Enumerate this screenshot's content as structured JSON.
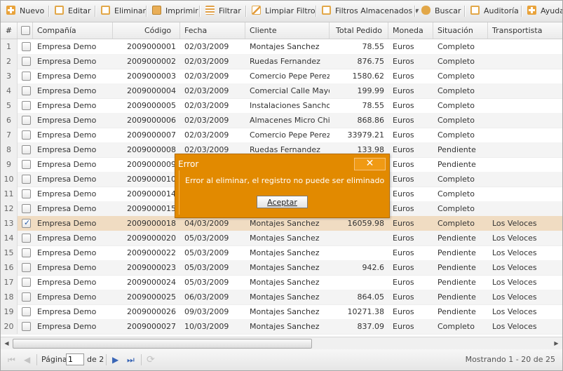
{
  "toolbar": {
    "new_label": "Nuevo",
    "edit_label": "Editar",
    "delete_label": "Eliminar",
    "print_label": "Imprimir",
    "filter_label": "Filtrar",
    "clear_filter_label": "Limpiar Filtro",
    "stored_filters_label": "Filtros Almacenados",
    "search_label": "Buscar",
    "audit_label": "Auditoría",
    "help_label": "Ayuda"
  },
  "grid": {
    "columns": [
      "#",
      "",
      "Compañía",
      "Código",
      "Fecha",
      "Cliente",
      "Total Pedido",
      "Moneda",
      "Situación",
      "Transportista"
    ],
    "rows": [
      {
        "n": "1",
        "checked": false,
        "company": "Empresa Demo",
        "code": "2009000001",
        "date": "02/03/2009",
        "client": "Montajes Sanchez",
        "total": "78.55",
        "currency": "Euros",
        "status": "Completo",
        "carrier": ""
      },
      {
        "n": "2",
        "checked": false,
        "company": "Empresa Demo",
        "code": "2009000002",
        "date": "02/03/2009",
        "client": "Ruedas Fernandez",
        "total": "876.75",
        "currency": "Euros",
        "status": "Completo",
        "carrier": ""
      },
      {
        "n": "3",
        "checked": false,
        "company": "Empresa Demo",
        "code": "2009000003",
        "date": "02/03/2009",
        "client": "Comercio Pepe Perez",
        "total": "1580.62",
        "currency": "Euros",
        "status": "Completo",
        "carrier": ""
      },
      {
        "n": "4",
        "checked": false,
        "company": "Empresa Demo",
        "code": "2009000004",
        "date": "02/03/2009",
        "client": "Comercial Calle Mayor",
        "total": "199.99",
        "currency": "Euros",
        "status": "Completo",
        "carrier": ""
      },
      {
        "n": "5",
        "checked": false,
        "company": "Empresa Demo",
        "code": "2009000005",
        "date": "02/03/2009",
        "client": "Instalaciones Sancho",
        "total": "78.55",
        "currency": "Euros",
        "status": "Completo",
        "carrier": ""
      },
      {
        "n": "6",
        "checked": false,
        "company": "Empresa Demo",
        "code": "2009000006",
        "date": "02/03/2009",
        "client": "Almacenes Micro Chip",
        "total": "868.86",
        "currency": "Euros",
        "status": "Completo",
        "carrier": ""
      },
      {
        "n": "7",
        "checked": false,
        "company": "Empresa Demo",
        "code": "2009000007",
        "date": "02/03/2009",
        "client": "Comercio Pepe Perez",
        "total": "33979.21",
        "currency": "Euros",
        "status": "Completo",
        "carrier": ""
      },
      {
        "n": "8",
        "checked": false,
        "company": "Empresa Demo",
        "code": "2009000008",
        "date": "02/03/2009",
        "client": "Ruedas Fernandez",
        "total": "133.98",
        "currency": "Euros",
        "status": "Pendiente",
        "carrier": ""
      },
      {
        "n": "9",
        "checked": false,
        "company": "Empresa Demo",
        "code": "2009000009",
        "date": "",
        "client": "",
        "total": "",
        "currency": "Euros",
        "status": "Pendiente",
        "carrier": ""
      },
      {
        "n": "10",
        "checked": false,
        "company": "Empresa Demo",
        "code": "2009000010",
        "date": "",
        "client": "",
        "total": "",
        "currency": "Euros",
        "status": "Completo",
        "carrier": ""
      },
      {
        "n": "11",
        "checked": false,
        "company": "Empresa Demo",
        "code": "2009000014",
        "date": "",
        "client": "",
        "total": "",
        "currency": "Euros",
        "status": "Completo",
        "carrier": ""
      },
      {
        "n": "12",
        "checked": false,
        "company": "Empresa Demo",
        "code": "2009000015",
        "date": "",
        "client": "",
        "total": "",
        "currency": "Euros",
        "status": "Completo",
        "carrier": ""
      },
      {
        "n": "13",
        "checked": true,
        "company": "Empresa Demo",
        "code": "2009000018",
        "date": "04/03/2009",
        "client": "Montajes Sanchez",
        "total": "16059.98",
        "currency": "Euros",
        "status": "Completo",
        "carrier": "Los Veloces"
      },
      {
        "n": "14",
        "checked": false,
        "company": "Empresa Demo",
        "code": "2009000020",
        "date": "05/03/2009",
        "client": "Montajes Sanchez",
        "total": "",
        "currency": "Euros",
        "status": "Pendiente",
        "carrier": "Los Veloces"
      },
      {
        "n": "15",
        "checked": false,
        "company": "Empresa Demo",
        "code": "2009000022",
        "date": "05/03/2009",
        "client": "Montajes Sanchez",
        "total": "",
        "currency": "Euros",
        "status": "Pendiente",
        "carrier": "Los Veloces"
      },
      {
        "n": "16",
        "checked": false,
        "company": "Empresa Demo",
        "code": "2009000023",
        "date": "05/03/2009",
        "client": "Montajes Sanchez",
        "total": "942.6",
        "currency": "Euros",
        "status": "Pendiente",
        "carrier": "Los Veloces"
      },
      {
        "n": "17",
        "checked": false,
        "company": "Empresa Demo",
        "code": "2009000024",
        "date": "05/03/2009",
        "client": "Montajes Sanchez",
        "total": "",
        "currency": "Euros",
        "status": "Pendiente",
        "carrier": "Los Veloces"
      },
      {
        "n": "18",
        "checked": false,
        "company": "Empresa Demo",
        "code": "2009000025",
        "date": "06/03/2009",
        "client": "Montajes Sanchez",
        "total": "864.05",
        "currency": "Euros",
        "status": "Pendiente",
        "carrier": "Los Veloces"
      },
      {
        "n": "19",
        "checked": false,
        "company": "Empresa Demo",
        "code": "2009000026",
        "date": "09/03/2009",
        "client": "Montajes Sanchez",
        "total": "10271.38",
        "currency": "Euros",
        "status": "Pendiente",
        "carrier": "Los Veloces"
      },
      {
        "n": "20",
        "checked": false,
        "company": "Empresa Demo",
        "code": "2009000027",
        "date": "10/03/2009",
        "client": "Montajes Sanchez",
        "total": "837.09",
        "currency": "Euros",
        "status": "Completo",
        "carrier": "Los Veloces"
      }
    ],
    "selected_row": "13"
  },
  "pager": {
    "page_label": "Página",
    "page_value": "1",
    "of_label": "de 2",
    "status": "Mostrando 1 - 20 de 25"
  },
  "dialog": {
    "title": "Error",
    "message": "Error al eliminar, el registro no puede ser eliminado",
    "ok_label": "Aceptar",
    "close_symbol": "✕"
  },
  "icons": {
    "new": "plus-icon",
    "edit": "edit-icon",
    "delete": "delete-icon",
    "print": "print-icon",
    "filter": "filter-icon",
    "clear_filter": "clear-filter-icon",
    "stored_filters": "stored-filters-icon",
    "search": "search-icon",
    "audit": "audit-icon",
    "help": "help-icon"
  },
  "colors": {
    "dialog_bg": "#e28a00",
    "selected_row": "#f0dcc2",
    "toolbar_icon": "#e9a33b"
  }
}
